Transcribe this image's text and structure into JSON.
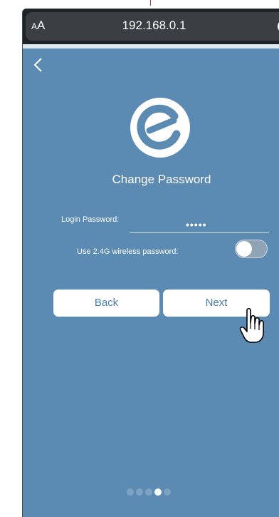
{
  "browser": {
    "text_size_label_small": "A",
    "text_size_label_large": "A",
    "url": "192.168.0.1"
  },
  "page": {
    "title": "Change Password",
    "login_password_label": "Login Password:",
    "login_password_value": "•••••",
    "wireless_toggle_label": "Use 2.4G wireless password:",
    "wireless_toggle_on": false
  },
  "buttons": {
    "back_label": "Back",
    "next_label": "Next"
  },
  "pager": {
    "total": 5,
    "active_index": 3
  },
  "colors": {
    "background": "#5b8ab2",
    "button_text": "#4a7ea8",
    "browser_bar": "#3b3f44"
  },
  "icons": {
    "back": "chevron-left-icon",
    "logo": "brand-logo-icon",
    "reload": "reload-icon",
    "cursor": "hand-pointer-icon"
  }
}
